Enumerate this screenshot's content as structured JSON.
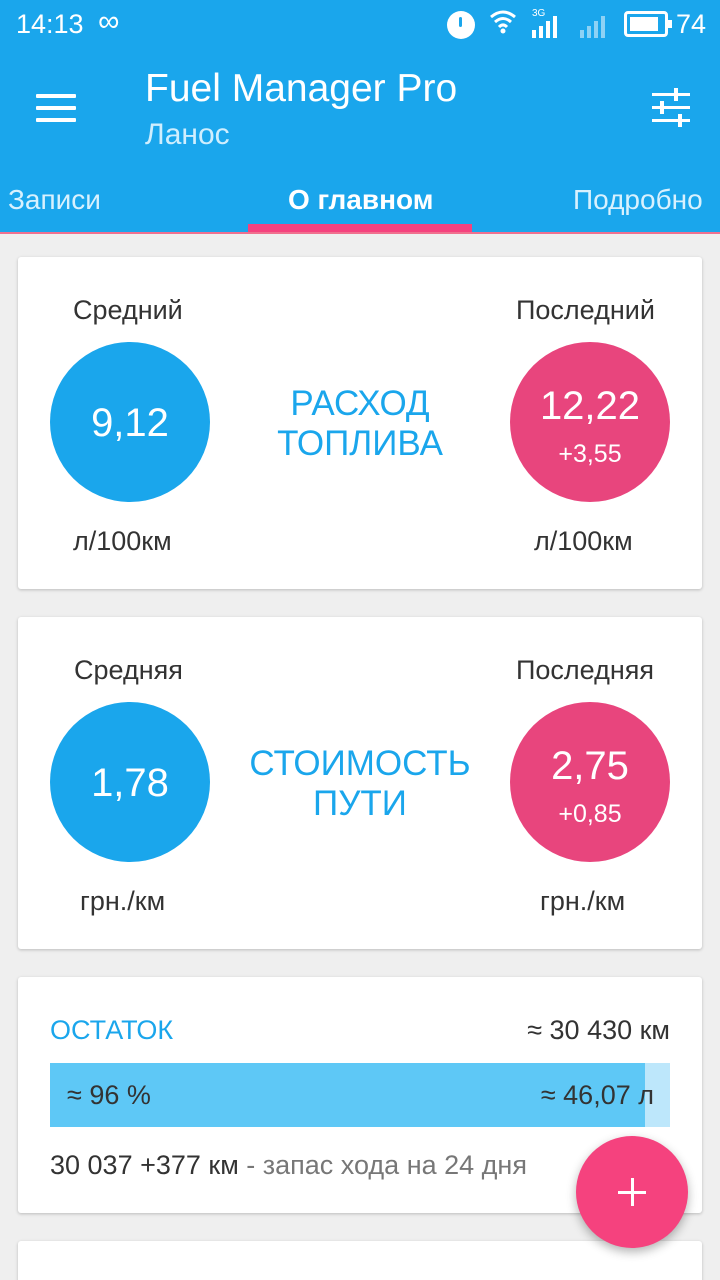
{
  "status_bar": {
    "time": "14:13",
    "infinity_glyph": "∞",
    "network_label": "3G",
    "battery_level": "74",
    "icons": [
      "infinity-icon",
      "alarm-icon",
      "wifi-icon",
      "signal-icon",
      "battery-icon"
    ]
  },
  "app_bar": {
    "title": "Fuel Manager Pro",
    "subtitle": "Ланос",
    "background_color": "#1aa6ec",
    "tabs": [
      {
        "label": "Записи",
        "active": false
      },
      {
        "label": "О главном",
        "active": true
      },
      {
        "label": "Подробно",
        "active": false
      }
    ],
    "indicator_color": "#f5427e"
  },
  "consumption": {
    "avg_label": "Средний",
    "avg_value": "9,12",
    "avg_unit": "л/100км",
    "title_line1": "РАСХОД",
    "title_line2": "ТОПЛИВА",
    "last_label": "Последний",
    "last_value": "12,22",
    "last_delta": "+3,55",
    "last_unit": "л/100км"
  },
  "cost": {
    "avg_label": "Средняя",
    "avg_value": "1,78",
    "avg_unit": "грн./км",
    "title_line1": "СТОИМОСТЬ",
    "title_line2": "ПУТИ",
    "last_label": "Последняя",
    "last_value": "2,75",
    "last_delta": "+0,85",
    "last_unit": "грн./км"
  },
  "remaining": {
    "title": "ОСТАТОК",
    "km": "≈ 30 430 км",
    "percent_label": "≈ 96 %",
    "percent_value": 96,
    "liters": "≈ 46,07 л",
    "odometer": "30 037 +377 км",
    "range_text": " - запас хода на 24 дня"
  },
  "fab": {
    "icon": "plus-icon",
    "glyph": "+"
  },
  "colors": {
    "blue": "#1aa6ec",
    "pink": "#e8457d",
    "fab": "#f5427e"
  }
}
